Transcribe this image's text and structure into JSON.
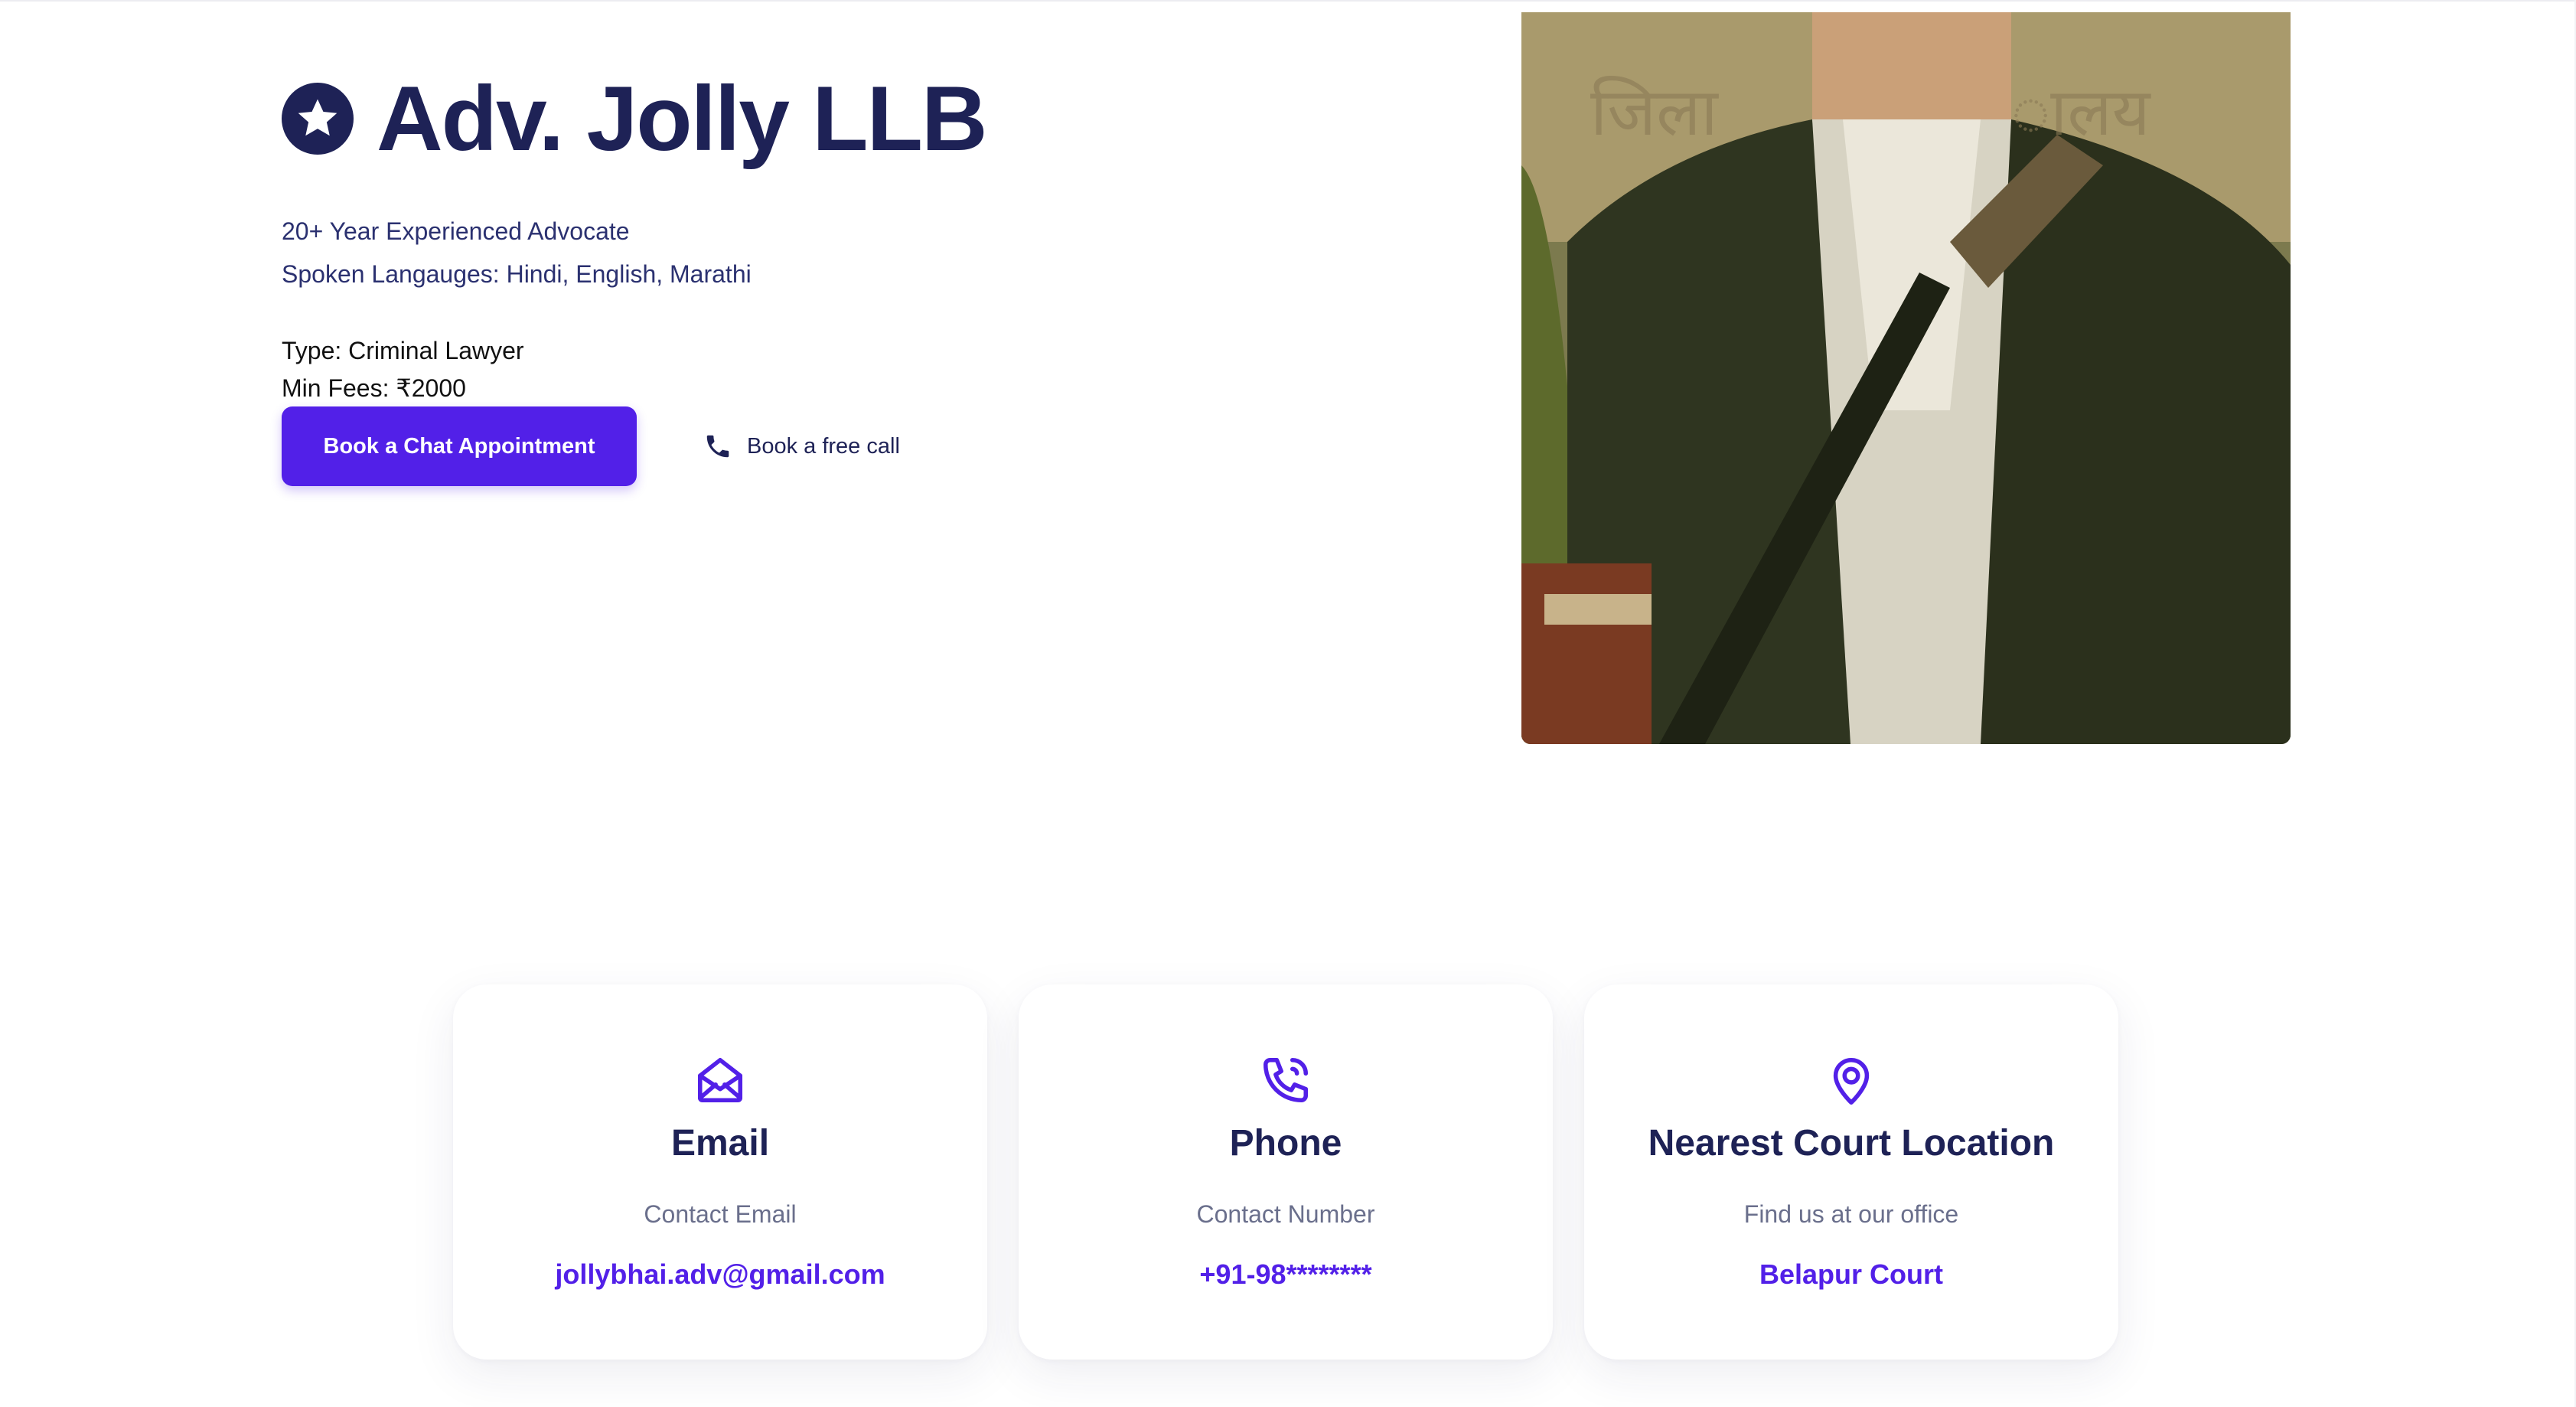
{
  "hero": {
    "title": "Adv. Jolly LLB",
    "experience": "20+ Year Experienced Advocate",
    "languages": "Spoken Langauges: Hindi, English, Marathi",
    "type": "Type: Criminal Lawyer",
    "fees": "Min Fees: ₹2000",
    "primary_button": "Book a Chat Appointment",
    "call_button": "Book a free call"
  },
  "contacts": [
    {
      "icon": "envelope-open-icon",
      "title": "Email",
      "subtitle": "Contact Email",
      "value": "jollybhai.adv@gmail.com"
    },
    {
      "icon": "phone-call-icon",
      "title": "Phone",
      "subtitle": "Contact Number",
      "value": "+91-98********"
    },
    {
      "icon": "map-pin-icon",
      "title": "Nearest Court Location",
      "subtitle": "Find us at our office",
      "value": "Belapur Court"
    }
  ],
  "colors": {
    "primary": "#5220e8",
    "heading": "#1e2256",
    "muted": "#6a6f8c"
  }
}
